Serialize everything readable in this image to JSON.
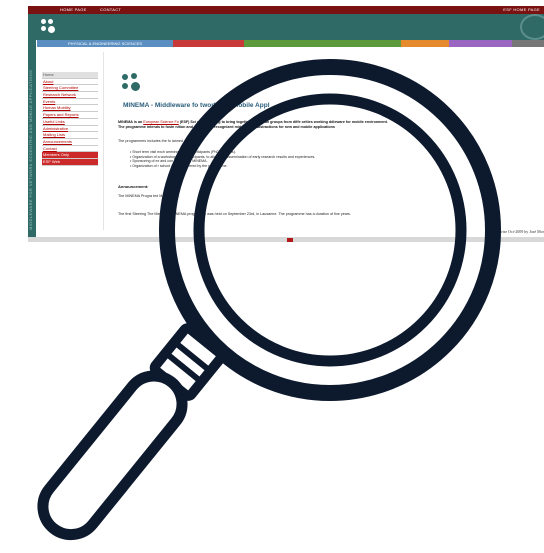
{
  "topbar": {
    "home": "HOME PAGE",
    "contact": "CONTACT",
    "esf": "ESF HOME PAGE"
  },
  "colorbar": {
    "label": "PHYSICAL & ENGINEERING SCIENCES",
    "colors": [
      "#5b8fc2",
      "#c83a3a",
      "#5c9a3c",
      "#e68a2e",
      "#9a66c2",
      "#777777"
    ]
  },
  "sidebar_text": "MIDDLEWARE FOR NETWORK ECCENTRIC AND MOBILE APPLICATIONS",
  "menu": [
    {
      "label": "Home",
      "style": "home"
    },
    {
      "label": "About",
      "style": "link"
    },
    {
      "label": "Steering Committee",
      "style": "link"
    },
    {
      "label": "Research Network",
      "style": "link"
    },
    {
      "label": "Events",
      "style": "link"
    },
    {
      "label": "Human Mobility",
      "style": "link"
    },
    {
      "label": "Papers and Reports",
      "style": "link"
    },
    {
      "label": "Useful Links",
      "style": "link"
    },
    {
      "label": "Administrative",
      "style": "link"
    },
    {
      "label": "Mailing Lists",
      "style": "link"
    },
    {
      "label": "Announcements",
      "style": "link"
    },
    {
      "label": "Contact",
      "style": "link"
    },
    {
      "label": "Members Only",
      "style": "red"
    },
    {
      "label": "ESF Web",
      "style": "red"
    }
  ],
  "content": {
    "title": "MINEMA - Middleware fo  twork Eco                Mobile Appl",
    "intro_1a": "MINEMA is an ",
    "intro_link": "European Science Fo",
    "intro_1b": "    (ESF) Sci                  amme aiming to bring together European groups from diffe                       orities working       ddleware for mobile environment.",
    "intro_2": "The programme intends to foste            nition and                   n of widely recognized middleware abstractions for new and             mobile applications",
    "includes": "The programmes includes the fo                   lanned act",
    "bullets": [
      "Short term visit exch       amming the          the participants (PhD students).",
      "Organization of a     workshop        mme participants, to allow the dissemination of early research results and experiences.",
      "Sponsoring of ex         and con          the area of MINEMA.",
      "Organization of         r school        objects covered by the programme."
    ],
    "announcement_title": "Announcement:",
    "announcement_1": "The MINEMA Progra        ted March  2006.",
    "announcement_2": "The first Steering         The Meeting        e MINEMA programme was held on September 23rd, in Lausanne. The programme has a duration of five years.",
    "last_revised": "Last revise            Oct-2009 by José Mor"
  }
}
